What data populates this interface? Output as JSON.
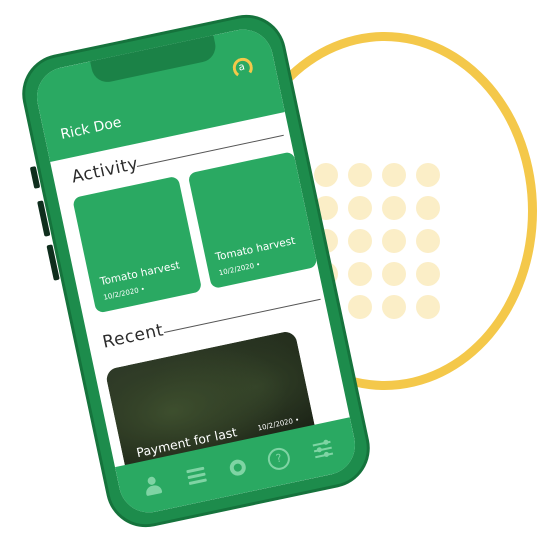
{
  "header": {
    "user_name": "Rick Doe",
    "logo_icon": "a-logo-icon"
  },
  "activity": {
    "section_title": "Activity",
    "cards": [
      {
        "title": "Tomato harvest",
        "date": "10/2/2020 •"
      },
      {
        "title": "Tomato harvest",
        "date": "10/2/2020 •"
      }
    ]
  },
  "recent": {
    "section_title": "Recent",
    "card": {
      "title": "Payment for last purchase",
      "date": "10/2/2020 •",
      "action_icon": "plus-icon",
      "action_label": "+"
    }
  },
  "bottom_nav": {
    "items": [
      {
        "icon": "user-icon"
      },
      {
        "icon": "list-icon"
      },
      {
        "icon": "home-circle-icon"
      },
      {
        "icon": "help-icon",
        "label": "?"
      },
      {
        "icon": "filter-sliders-icon"
      }
    ]
  },
  "colors": {
    "primary_green": "#2aa962",
    "dark_green": "#1d8c4c",
    "accent_yellow": "#f4c84a",
    "dot_color": "#fbeec7"
  }
}
